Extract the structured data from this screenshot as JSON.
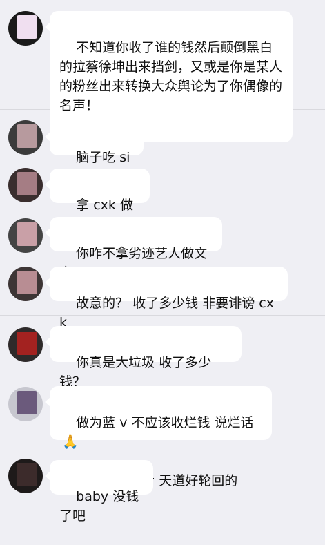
{
  "colors": {
    "background": "#efeff4",
    "bubble": "#ffffff",
    "text": "#111111",
    "divider": "#d9d9de"
  },
  "messages": [
    {
      "text": "不知道你收了谁的钱然后颠倒黑白的拉蔡徐坤出来挡剑，又或是你是某人的粉丝出来转换大众舆论为了你偶像的名声！",
      "avatar_color": "#f0dff0"
    },
    {
      "text": "脑子吃 si 了？",
      "avatar_color": "#b79a9e"
    },
    {
      "text": "拿 cxk 做文章",
      "avatar_color": "#a57d84"
    },
    {
      "text": "你咋不拿劣迹艺人做文章",
      "avatar_color": "#c9a0a7"
    },
    {
      "text": "故意的？ 收了多少钱 非要诽谤 cxk",
      "avatar_color": "#b88d93"
    },
    {
      "text": "你真是大垃圾 收了多少钱？",
      "avatar_color": "#a32220"
    },
    {
      "text": "做为蓝 v 不应该收烂钱 说烂话",
      "text2": "人在做天在看 天道好轮回的",
      "emoji": "praying-hands-icon",
      "avatar_color": "#6b5a7c"
    },
    {
      "text": "baby 没钱了吧",
      "avatar_color": "#3c2b2b"
    }
  ]
}
